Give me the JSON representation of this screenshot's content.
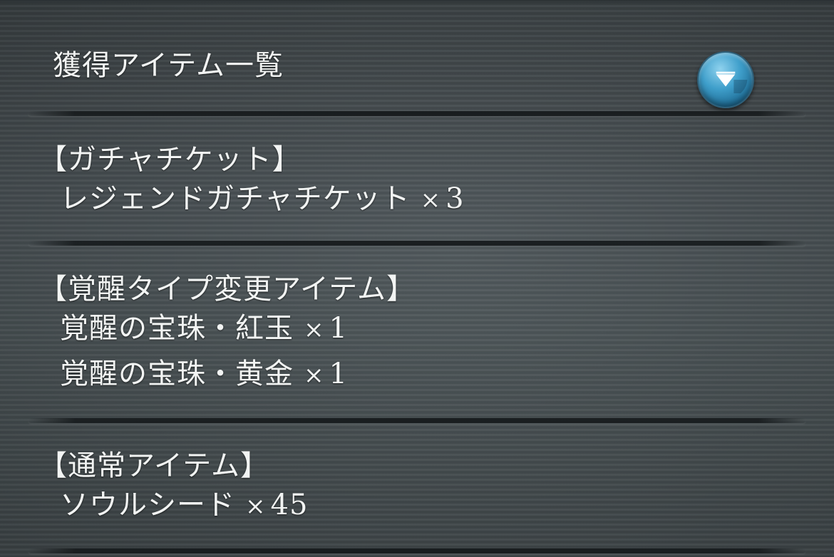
{
  "header": {
    "title": "獲得アイテム一覧",
    "dropdown_icon": "chevron-down-icon"
  },
  "sections": [
    {
      "header": "【ガチャチケット】",
      "items": [
        {
          "name": "レジェンドガチャチケット",
          "multiplier": "×",
          "quantity": "3"
        }
      ]
    },
    {
      "header": "【覚醒タイプ変更アイテム】",
      "items": [
        {
          "name": "覚醒の宝珠・紅玉",
          "multiplier": "×",
          "quantity": "1"
        },
        {
          "name": "覚醒の宝珠・黄金",
          "multiplier": "×",
          "quantity": "1"
        }
      ]
    },
    {
      "header": "【通常アイテム】",
      "items": [
        {
          "name": "ソウルシード",
          "multiplier": "×",
          "quantity": "45"
        }
      ]
    }
  ],
  "colors": {
    "background": "#434b4e",
    "text": "#f2f4f3",
    "button_accent": "#3f9fcb"
  }
}
